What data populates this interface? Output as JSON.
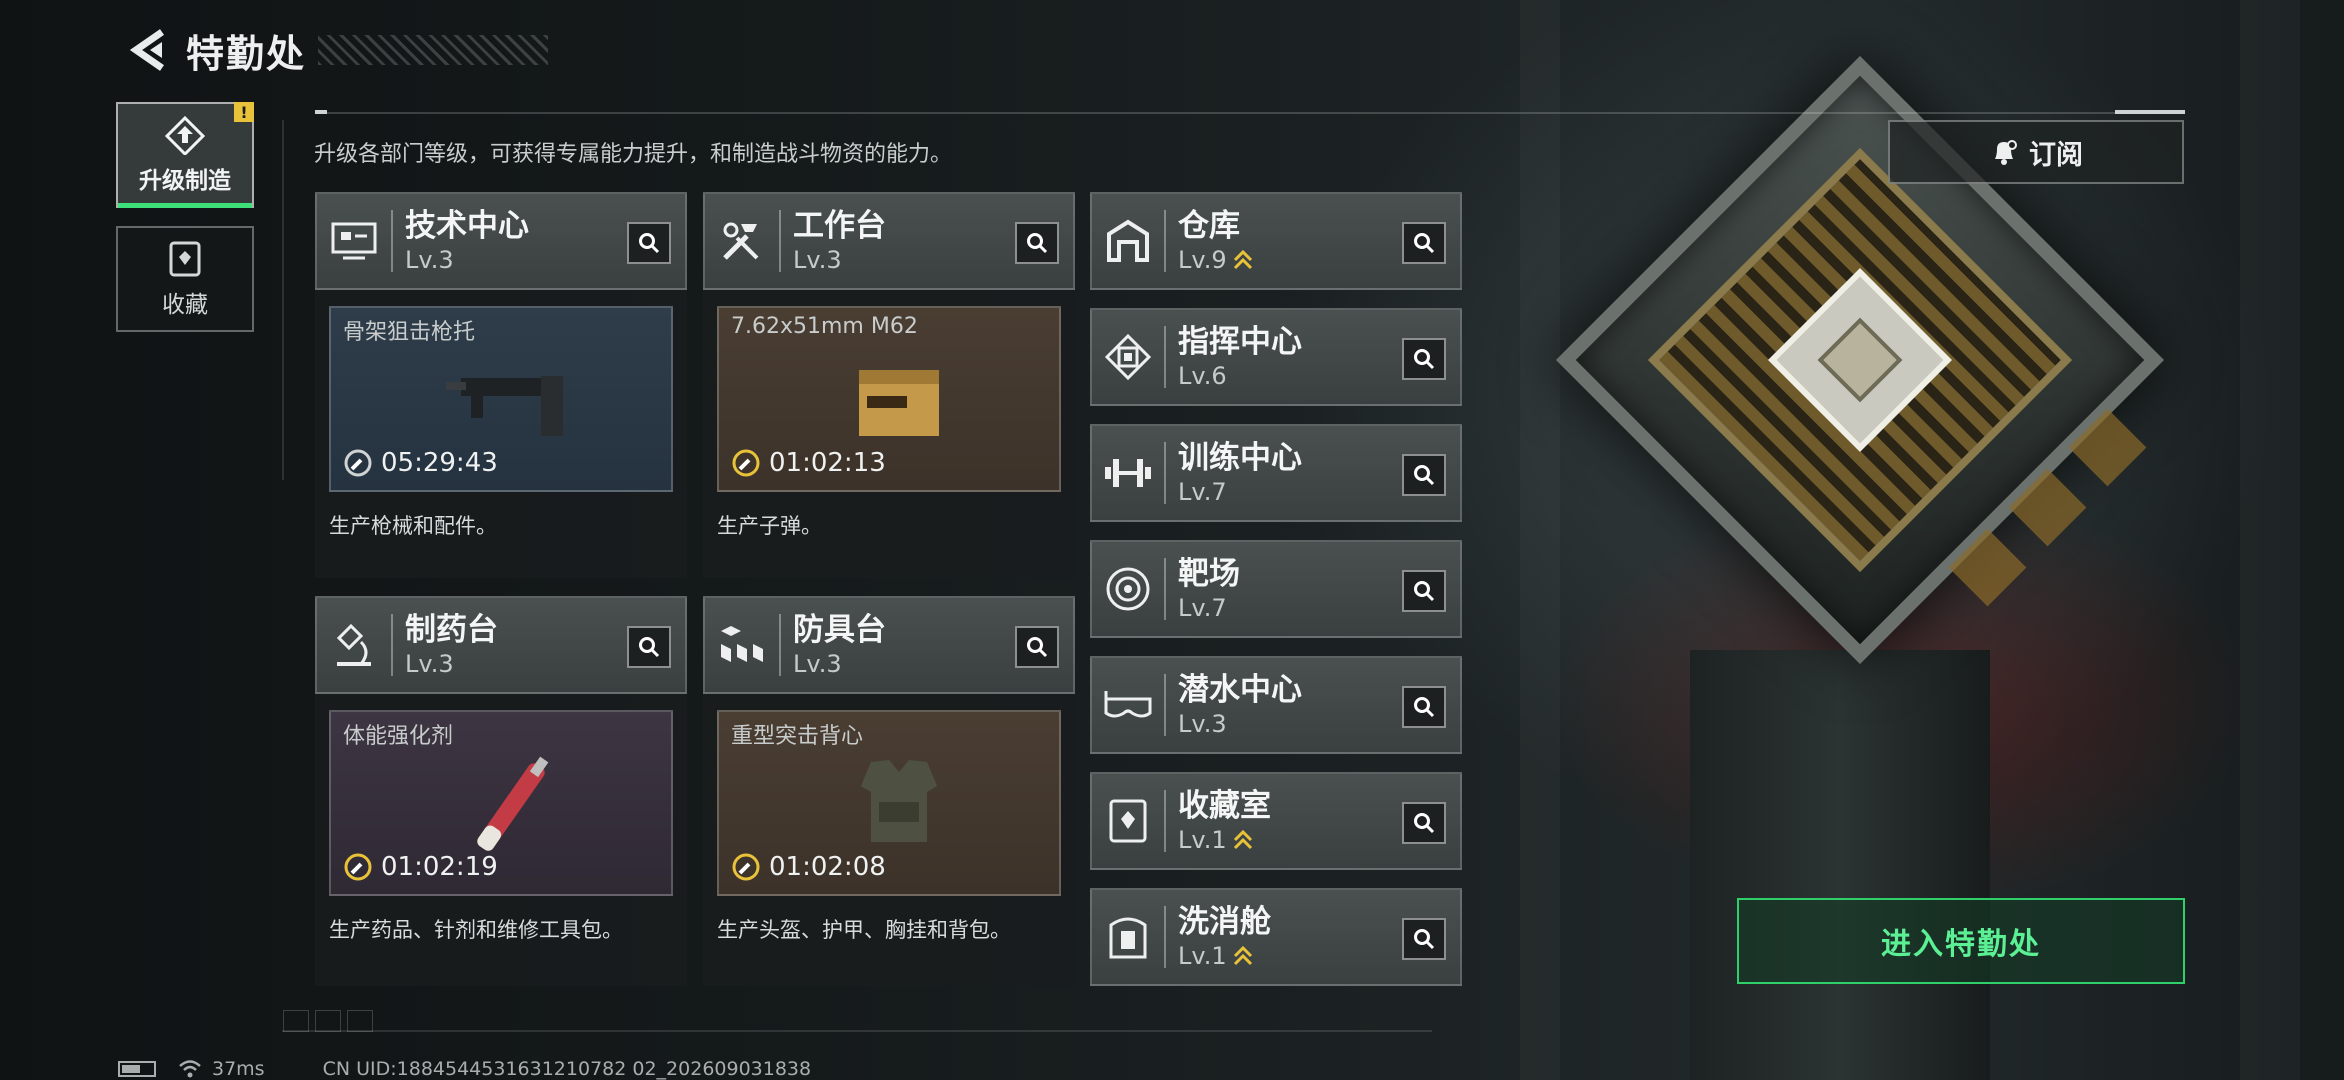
{
  "header": {
    "title": "特勤处",
    "subtitle": "升级各部门等级，可获得专属能力提升，和制造战斗物资的能力。"
  },
  "nav": [
    {
      "label": "升级制造",
      "icon": "upgrade-craft-icon",
      "badge": "!"
    },
    {
      "label": "收藏",
      "icon": "collection-icon"
    }
  ],
  "stations": [
    {
      "name": "技术中心",
      "level": "Lv.3",
      "icon": "tech-center-icon",
      "product": "骨架狙击枪托",
      "time": "05:29:43",
      "desc": "生产枪械和配件。",
      "box_color": "blue"
    },
    {
      "name": "工作台",
      "level": "Lv.3",
      "icon": "workbench-icon",
      "product": "7.62x51mm M62",
      "time": "01:02:13",
      "desc": "生产子弹。",
      "box_color": "brown"
    },
    {
      "name": "制药台",
      "level": "Lv.3",
      "icon": "pharmacy-icon",
      "product": "体能强化剂",
      "time": "01:02:19",
      "desc": "生产药品、针剂和维修工具包。",
      "box_color": "purple"
    },
    {
      "name": "防具台",
      "level": "Lv.3",
      "icon": "armor-bench-icon",
      "product": "重型突击背心",
      "time": "01:02:08",
      "desc": "生产头盔、护甲、胸挂和背包。",
      "box_color": "brown"
    }
  ],
  "facilities": [
    {
      "name": "仓库",
      "level": "Lv.9",
      "icon": "warehouse-icon",
      "upgradable": true
    },
    {
      "name": "指挥中心",
      "level": "Lv.6",
      "icon": "command-center-icon",
      "upgradable": false
    },
    {
      "name": "训练中心",
      "level": "Lv.7",
      "icon": "training-center-icon",
      "upgradable": false
    },
    {
      "name": "靶场",
      "level": "Lv.7",
      "icon": "shooting-range-icon",
      "upgradable": false
    },
    {
      "name": "潜水中心",
      "level": "Lv.3",
      "icon": "diving-center-icon",
      "upgradable": false
    },
    {
      "name": "收藏室",
      "level": "Lv.1",
      "icon": "collection-room-icon",
      "upgradable": true
    },
    {
      "name": "洗消舱",
      "level": "Lv.1",
      "icon": "decon-chamber-icon",
      "upgradable": true
    }
  ],
  "buttons": {
    "subscribe": "订阅",
    "enter": "进入特勤处"
  },
  "status": {
    "ping": "37ms",
    "uid": "CN UID:1884544531631210782 02_202609031838"
  },
  "colors": {
    "accent_green": "#2fd06a",
    "badge_yellow": "#e8c33a",
    "upgrade_gold": "#e8c33a"
  }
}
